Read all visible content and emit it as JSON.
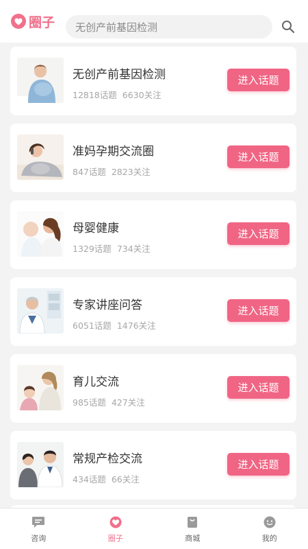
{
  "header": {
    "app_title": "圈子",
    "search_placeholder": "无创产前基因检测",
    "brand_color": "#ef6f8b"
  },
  "topics": [
    {
      "title": "无创产前基因检测",
      "topics_count": "12818话题",
      "followers": "6630关注",
      "button": "进入话题",
      "image": "pregnant-woman-photo"
    },
    {
      "title": "准妈孕期交流圈",
      "topics_count": "847话题",
      "followers": "2823关注",
      "button": "进入话题",
      "image": "pregnant-woman-phone-photo"
    },
    {
      "title": "母婴健康",
      "topics_count": "1329话题",
      "followers": "734关注",
      "button": "进入话题",
      "image": "mother-baby-photo"
    },
    {
      "title": "专家讲座问答",
      "topics_count": "6051话题",
      "followers": "1476关注",
      "button": "进入话题",
      "image": "doctor-photo"
    },
    {
      "title": "育儿交流",
      "topics_count": "985话题",
      "followers": "427关注",
      "button": "进入话题",
      "image": "mother-child-photo"
    },
    {
      "title": "常规产检交流",
      "topics_count": "434话题",
      "followers": "66关注",
      "button": "进入话题",
      "image": "doctor-consultation-photo"
    }
  ],
  "tabbar": {
    "items": [
      {
        "label": "咨询",
        "icon": "chat-icon",
        "active": false
      },
      {
        "label": "圈子",
        "icon": "heart-icon",
        "active": true
      },
      {
        "label": "商城",
        "icon": "shop-bag-icon",
        "active": false
      },
      {
        "label": "我的",
        "icon": "profile-face-icon",
        "active": false
      }
    ]
  },
  "colors": {
    "accent": "#f06584",
    "background": "#f3f3f3",
    "card": "#ffffff"
  }
}
